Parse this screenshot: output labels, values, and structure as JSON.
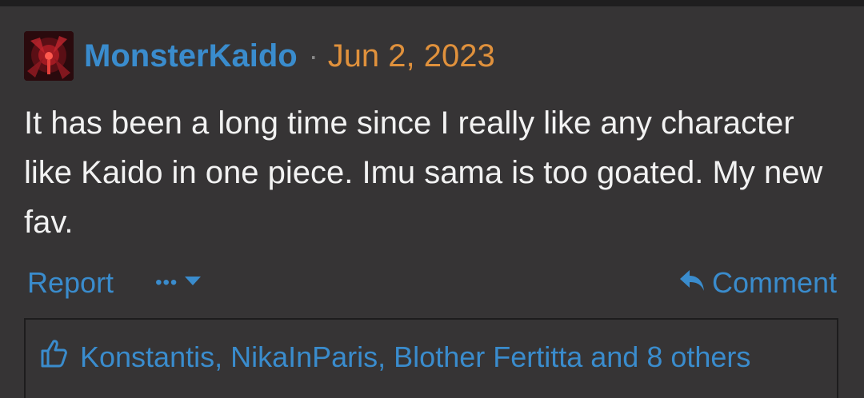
{
  "post": {
    "author": "MonsterKaido",
    "separator": "·",
    "date": "Jun 2, 2023",
    "message": "It has been a long time since I really like any character like Kaido in one piece. Imu sama is too goated. My new fav."
  },
  "actions": {
    "report_label": "Report",
    "more_label": "•••",
    "comment_label": "Comment"
  },
  "reactions": {
    "likes_text": "Konstantis, NikaInParis, Blother Fertitta and 8 others"
  },
  "colors": {
    "background": "#363435",
    "link": "#3a8ccd",
    "date": "#e0913c",
    "text": "#f2f2f2"
  },
  "icons": {
    "more_caret": "caret-down-icon",
    "comment": "reply-arrow-icon",
    "likes": "thumbs-up-icon"
  }
}
